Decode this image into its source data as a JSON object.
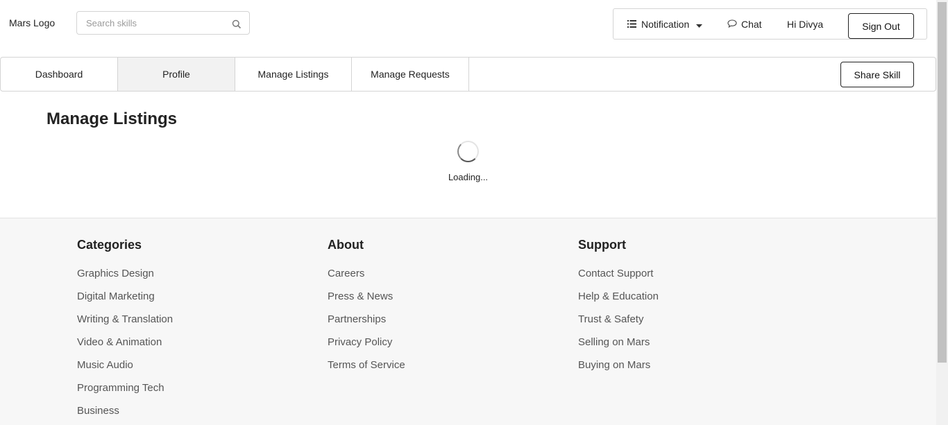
{
  "header": {
    "logo": "Mars Logo",
    "search_placeholder": "Search skills",
    "notification_label": "Notification",
    "chat_label": "Chat",
    "greeting": "Hi Divya",
    "signout_label": "Sign Out"
  },
  "tabs": [
    {
      "label": "Dashboard",
      "active": false
    },
    {
      "label": "Profile",
      "active": true
    },
    {
      "label": "Manage Listings",
      "active": false
    },
    {
      "label": "Manage Requests",
      "active": false
    }
  ],
  "share_label": "Share Skill",
  "main": {
    "title": "Manage Listings",
    "loading_text": "Loading..."
  },
  "footer": {
    "columns": [
      {
        "heading": "Categories",
        "links": [
          "Graphics Design",
          "Digital Marketing",
          "Writing & Translation",
          "Video & Animation",
          "Music Audio",
          "Programming Tech",
          "Business"
        ]
      },
      {
        "heading": "About",
        "links": [
          "Careers",
          "Press & News",
          "Partnerships",
          "Privacy Policy",
          "Terms of Service"
        ]
      },
      {
        "heading": "Support",
        "links": [
          "Contact Support",
          "Help & Education",
          "Trust & Safety",
          "Selling on Mars",
          "Buying on Mars"
        ]
      }
    ]
  },
  "icons": {
    "search": "search-icon",
    "notification": "list-icon",
    "caret": "caret-down-icon",
    "chat": "chat-bubble-icon"
  }
}
